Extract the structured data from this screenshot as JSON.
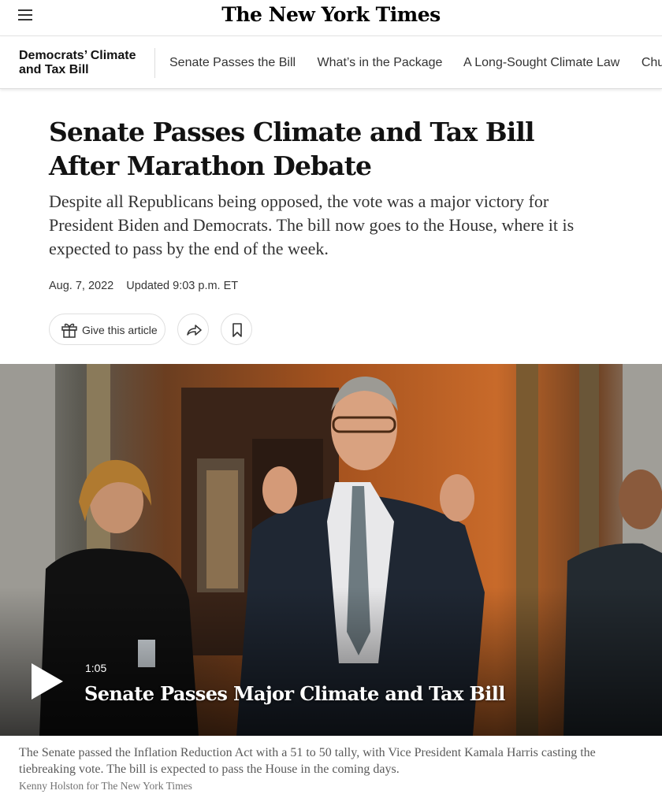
{
  "masthead": {
    "logo_text": "The New York Times"
  },
  "subnav": {
    "section_title": "Democrats’ Climate and Tax Bill",
    "links": [
      "Senate Passes the Bill",
      "What’s in the Package",
      "A Long-Sought Climate Law",
      "Chuck"
    ]
  },
  "article": {
    "headline": "Senate Passes Climate and Tax Bill After Marathon Debate",
    "summary": "Despite all Republicans being opposed, the vote was a major victory for President Biden and Democrats. The bill now goes to the House, where it is expected to pass by the end of the week.",
    "date": "Aug. 7, 2022",
    "updated": "Updated 9:03 p.m. ET"
  },
  "actions": {
    "gift_label": "Give this article",
    "gift_icon": "gift-icon",
    "share_icon": "share-icon",
    "save_icon": "bookmark-icon"
  },
  "video": {
    "duration": "1:05",
    "title": "Senate Passes Major Climate and Tax Bill",
    "play_icon": "play-icon"
  },
  "caption": {
    "text": "The Senate passed the Inflation Reduction Act with a 51 to 50 tally, with Vice President Kamala Harris casting the tiebreaking vote. The bill is expected to pass the House in the coming days.",
    "credit": "Kenny Holston for The New York Times"
  }
}
